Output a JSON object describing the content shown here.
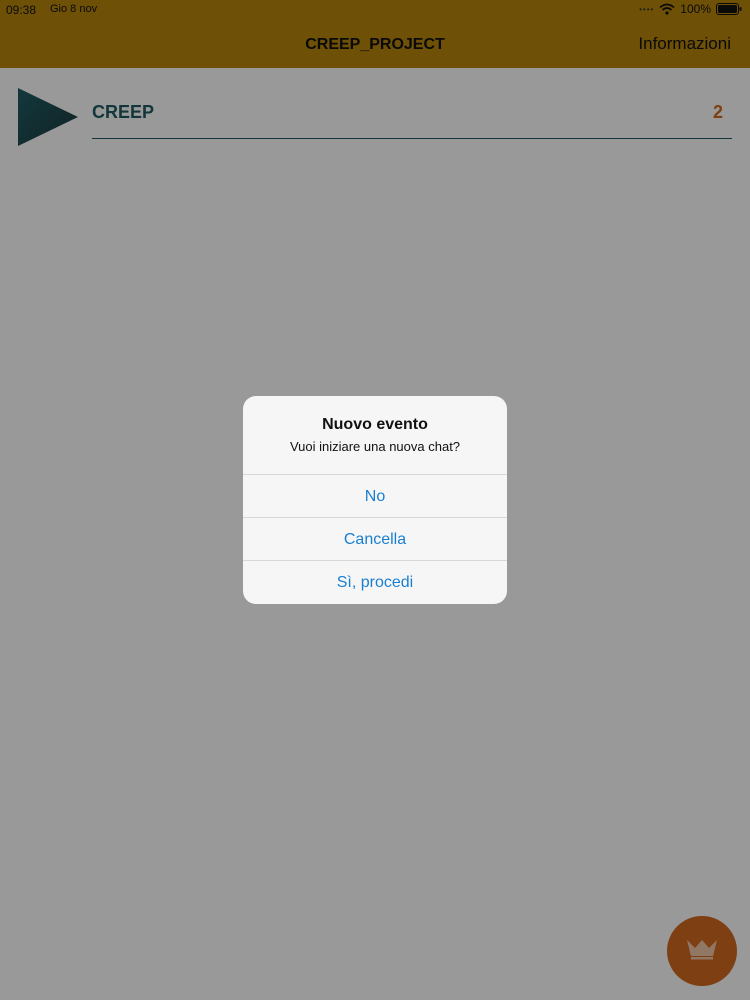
{
  "status_bar": {
    "time": "09:38",
    "date": "Gio 8 nov",
    "battery": "100%"
  },
  "nav": {
    "title": "CREEP_PROJECT",
    "info_label": "Informazioni"
  },
  "list": {
    "items": [
      {
        "title": "CREEP",
        "count": "2"
      }
    ]
  },
  "dialog": {
    "title": "Nuovo evento",
    "message": "Vuoi iniziare una nuova chat?",
    "actions": [
      {
        "label": "No"
      },
      {
        "label": "Cancella"
      },
      {
        "label": "Sì, procedi"
      }
    ]
  },
  "icons": {
    "item": "play-icon",
    "fab": "crown-icon"
  },
  "colors": {
    "header": "#b8860b",
    "item_title": "#1f5a60",
    "item_count": "#d2691e",
    "fab": "#d2691e",
    "dialog_action": "#1a7fd1"
  }
}
